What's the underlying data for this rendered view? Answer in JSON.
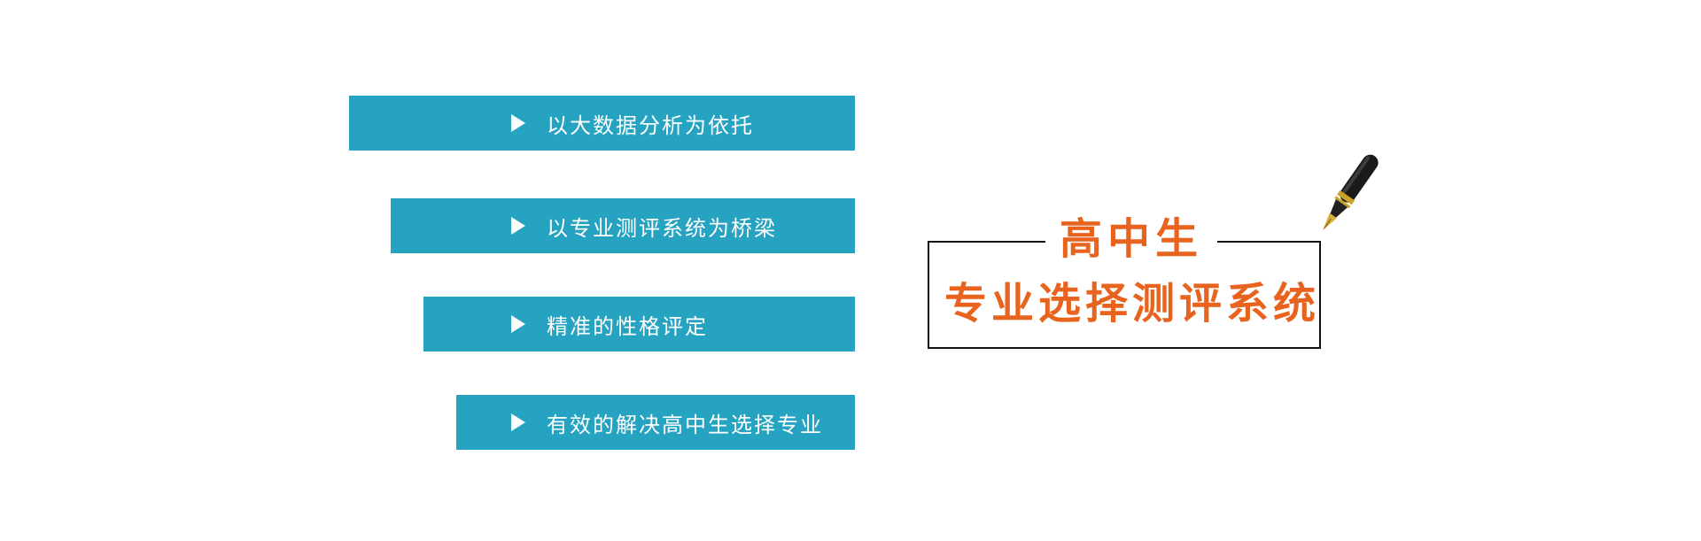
{
  "features": {
    "items": [
      {
        "label": "以大数据分析为依托"
      },
      {
        "label": "以专业测评系统为桥梁"
      },
      {
        "label": "精准的性格评定"
      },
      {
        "label": "有效的解决高中生选择专业"
      }
    ]
  },
  "title": {
    "line1": "高中生",
    "line2": "专业选择测评系统"
  },
  "colors": {
    "bar": "#27a3c2",
    "title_accent": "#e8641e",
    "border": "#111111"
  },
  "icons": {
    "bullet": "play-triangle-icon",
    "pen": "fountain-pen-icon"
  }
}
